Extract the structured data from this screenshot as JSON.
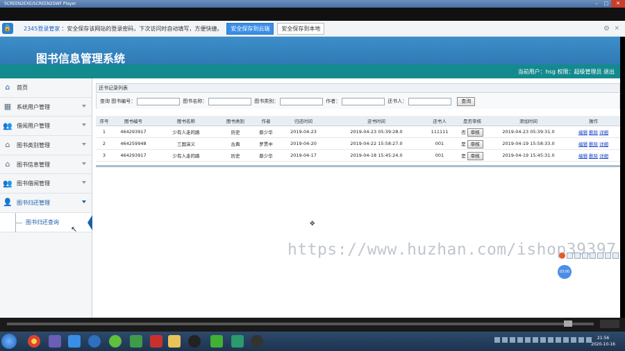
{
  "window": {
    "title": "SCREEN2EXE/SCREEN2SWF Player"
  },
  "password_bar": {
    "brand": "2345登录管家",
    "message": "：安全保存该网站的登录密码，下次访问时自动填写，方便快捷。",
    "save_cloud": "安全保存到云端",
    "save_local": "安全保存到本地"
  },
  "header": {
    "title": "图书信息管理系统"
  },
  "userbar": {
    "text": "当前用户：hsg 权限：超级管理员 退出"
  },
  "sidebar": {
    "items": [
      {
        "label": "首页"
      },
      {
        "label": "系统用户管理"
      },
      {
        "label": "借阅用户管理"
      },
      {
        "label": "图书类别管理"
      },
      {
        "label": "图书信息管理"
      },
      {
        "label": "图书借阅管理"
      },
      {
        "label": "图书归还管理"
      }
    ],
    "sub_item": "图书归还查询"
  },
  "panel": {
    "title": "还书记录列表"
  },
  "filter": {
    "label_query": "查询",
    "label_book_no": "图书编号：",
    "label_book_name": "图书名称：",
    "label_category": "图书类别：",
    "label_author": "作者：",
    "label_returner": "还书人：",
    "search_button": "查询"
  },
  "table": {
    "headers": [
      "序号",
      "图书编号",
      "图书名称",
      "图书类别",
      "作者",
      "归还时间",
      "还书时间",
      "还书人",
      "是否审核",
      "添加时间",
      "操作"
    ],
    "rows": [
      {
        "no": "1",
        "book_no": "464293917",
        "name": "少有人走的路",
        "category": "历史",
        "author": "蔡少华",
        "due": "2019-04-23",
        "returned": "2019-04-23 05:39:28.0",
        "returner": "111111",
        "audited": "否",
        "added": "2019-04-23 05:39:31.0"
      },
      {
        "no": "2",
        "book_no": "464259948",
        "name": "三国演义",
        "category": "古典",
        "author": "罗贯中",
        "due": "2019-04-20",
        "returned": "2019-04-22 15:58:27.0",
        "returner": "001",
        "audited": "是",
        "added": "2019-04-19 15:58:33.0"
      },
      {
        "no": "3",
        "book_no": "464293917",
        "name": "少有人走的路",
        "category": "历史",
        "author": "蔡少华",
        "due": "2019-04-17",
        "returned": "2019-04-18 15:45:24.0",
        "returner": "001",
        "audited": "是",
        "added": "2019-04-19 15:45:31.0"
      }
    ],
    "audit_button": "审核",
    "actions": [
      "编辑",
      "删除",
      "详细"
    ]
  },
  "watermark": "https://www.huzhan.com/ishop39397",
  "bubble": "03:00",
  "clock": {
    "time": "21:56",
    "date": "2020-10-16"
  }
}
